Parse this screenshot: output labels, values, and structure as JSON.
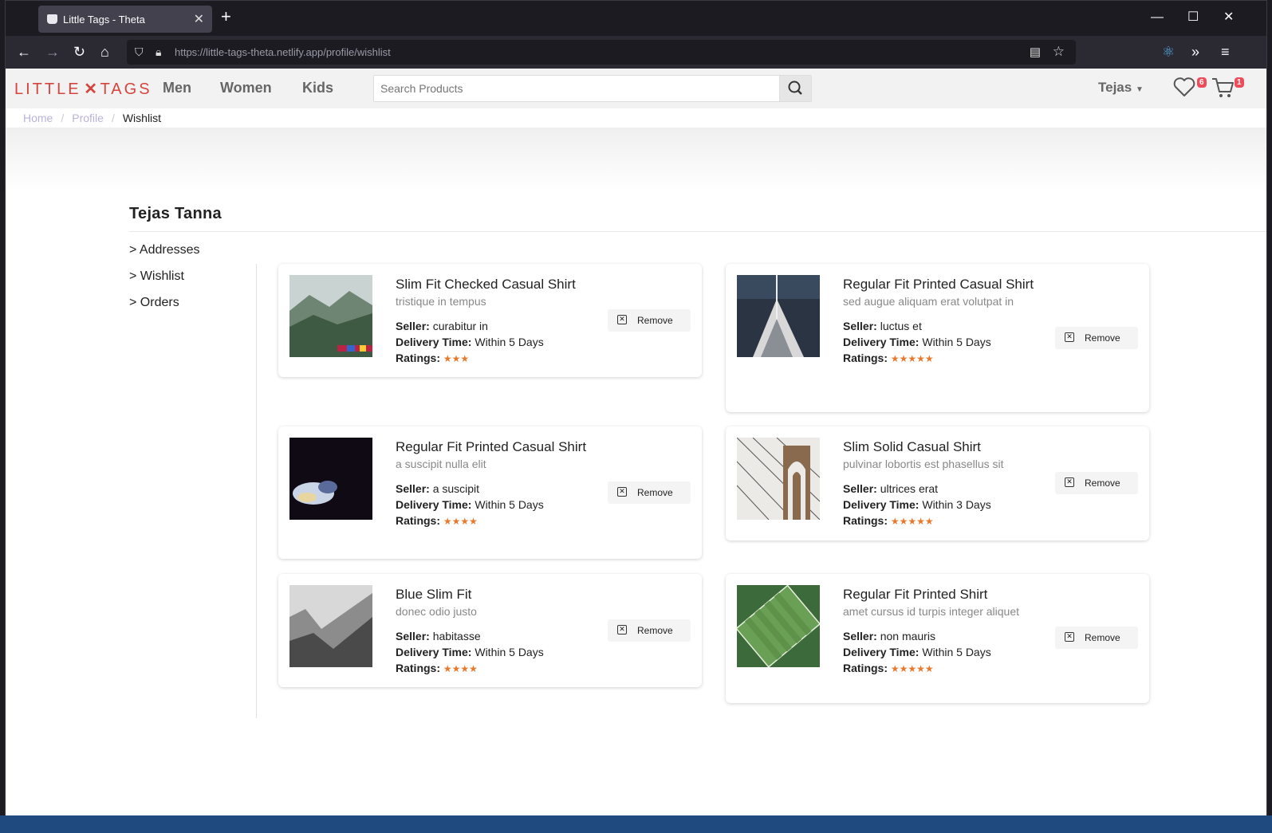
{
  "browser": {
    "tab_title": "Little Tags - Theta",
    "tab_close": "✕",
    "new_tab": "+",
    "url_host": "https://little-tags-theta.netlify.app",
    "url_path": "/profile/wishlist"
  },
  "header": {
    "logo_left": "LITTLE",
    "logo_mark": "✕",
    "logo_right": "TAGS",
    "nav": [
      "Men",
      "Women",
      "Kids"
    ],
    "search_placeholder": "Search Products",
    "user": "Tejas",
    "wishlist_count": "6",
    "cart_count": "1"
  },
  "breadcrumb": {
    "home": "Home",
    "profile": "Profile",
    "current": "Wishlist"
  },
  "profile": {
    "name": "Tejas Tanna",
    "menu": [
      "> Addresses",
      "> Wishlist",
      "> Orders"
    ]
  },
  "labels": {
    "seller": "Seller:",
    "delivery": "Delivery Time:",
    "ratings": "Ratings:",
    "remove": "Remove"
  },
  "products": [
    {
      "title": "Slim Fit Checked Casual Shirt",
      "desc": "tristique in tempus",
      "seller": "curabitur in",
      "delivery": "Within 5 Days",
      "stars": "★★★",
      "rating": 3,
      "image": "mountain-mist"
    },
    {
      "title": "Regular Fit Printed Casual Shirt",
      "desc": "sed augue aliquam erat volutpat in",
      "seller": "luctus et",
      "delivery": "Within 5 Days",
      "stars": "★★★★★",
      "rating": 5,
      "image": "sailboat"
    },
    {
      "title": "Regular Fit Printed Casual Shirt",
      "desc": "a suscipit nulla elit",
      "seller": "a suscipit",
      "delivery": "Within 5 Days",
      "stars": "★★★★",
      "rating": 4,
      "image": "dark-smoke"
    },
    {
      "title": "Slim Solid Casual Shirt",
      "desc": "pulvinar lobortis est phasellus sit",
      "seller": "ultrices erat",
      "delivery": "Within 3 Days",
      "stars": "★★★★★",
      "rating": 5,
      "image": "bridge"
    },
    {
      "title": "Blue Slim Fit",
      "desc": "donec odio justo",
      "seller": "habitasse",
      "delivery": "Within 5 Days",
      "stars": "★★★★",
      "rating": 4,
      "image": "grey-valley"
    },
    {
      "title": "Regular Fit Printed Shirt",
      "desc": "amet cursus id turpis integer aliquet",
      "seller": "non mauris",
      "delivery": "Within 5 Days",
      "stars": "★★★★★",
      "rating": 5,
      "image": "football-field"
    }
  ],
  "colors": {
    "brand": "#d6453d",
    "star": "#e8792c",
    "badge": "#f04b5a"
  }
}
